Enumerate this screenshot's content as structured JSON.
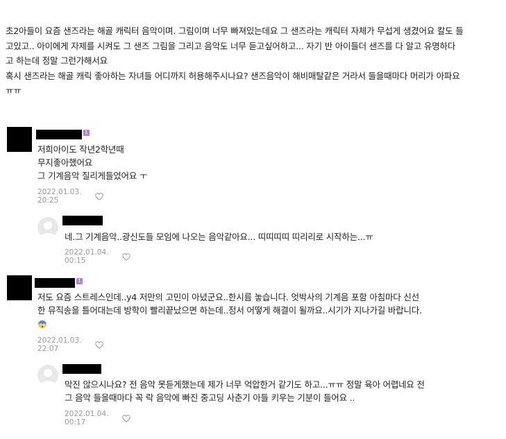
{
  "post": {
    "lines": [
      "초2아들이 요즘 샌즈라는 해골 캐릭터 음악이며. 그림이며 너무 빠져있는데요 그 샌즈라는 캐릭터 자체가 무섭게 생겼어요 칼도 들",
      "고있고.. 아이에게 자제를 시켜도 그 샌즈 그림을 그리고 음악도 너무 듣고싶어하고... 자기 반 아이들더 샌즈를 다 알고 유명하다",
      "고 하는데 정말 그런가해서요",
      "혹시 샌즈라는 해골 캐릭 좋아하는 자녀들 어디까지 허용해주시나요? 샌즈음악이 해비매탈같은 거라서 들을때마다 머리가 아파요",
      "ㅠㅠ"
    ]
  },
  "comments": [
    {
      "badge": "1",
      "lines": [
        "저희아이도 작년2학년때",
        "무지좋아했어요",
        "그 기계음악 질리게들었어요 ㅜ"
      ],
      "date": "2022.01.03. 20:25"
    },
    {
      "lines": [
        "네.그 기계음악..광신도들 모임에 나오는 음악같아요... 띠띠띠띠 띠리리로 시작하는...ㅠ"
      ],
      "date": "2022.01.04. 00:15"
    },
    {
      "badge": "1",
      "lines": [
        "저도 요즘 스트레스인데..y4 저만의 고민이 아녔군요..한시름 놓습니다. 엇박사의 기계음 포함 아침마다 신선",
        "한 뮤직송을 틀어대는데 방학이 빨리끝났으면 하는데..정서 어떻게 해결이 될까요..시기가 지나가길 바랍니다."
      ],
      "emoji": "scream-emoji",
      "date": "2022.01.03. 22:07"
    },
    {
      "lines": [
        "막진 않으시나요? 전 음악 못듣게했는데 제가 너무 억압한거 같기도 하고...ㅠㅠ 정말 육아 어렵네요 전",
        "그 음악 들을때마다 꼭 락 음악에 빠진 중고딩 사춘기 아들 키우는 기분이 들어요 .."
      ],
      "date": "2022.01.04. 00:17"
    }
  ],
  "icons": {
    "like": "heart-icon",
    "avatar": "default-profile-icon"
  },
  "colors": {
    "badge": "#b07fe0",
    "meta": "#9a9a9a",
    "redaction": "#000000"
  }
}
